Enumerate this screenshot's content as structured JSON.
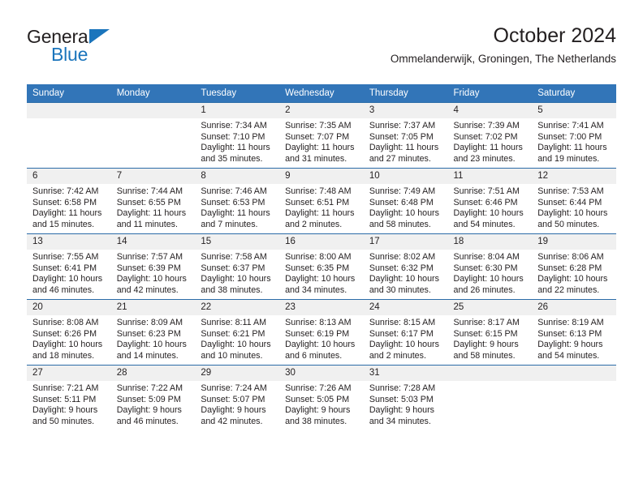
{
  "brand": {
    "name_top": "General",
    "name_bottom": "Blue",
    "triangle_color": "#1b75bc"
  },
  "header": {
    "title": "October 2024",
    "subtitle": "Ommelanderwijk, Groningen, The Netherlands"
  },
  "colors": {
    "header_blue": "#3275b8",
    "daynum_band": "#f0f0f0",
    "text": "#231f20"
  },
  "weekday_headers": [
    "Sunday",
    "Monday",
    "Tuesday",
    "Wednesday",
    "Thursday",
    "Friday",
    "Saturday"
  ],
  "labels": {
    "sunrise_prefix": "Sunrise:",
    "sunset_prefix": "Sunset:",
    "daylight_prefix": "Daylight:"
  },
  "weeks": [
    [
      {
        "day": "",
        "empty": true
      },
      {
        "day": "",
        "empty": true
      },
      {
        "day": "1",
        "sunrise": "Sunrise: 7:34 AM",
        "sunset": "Sunset: 7:10 PM",
        "daylight1": "Daylight: 11 hours",
        "daylight2": "and 35 minutes."
      },
      {
        "day": "2",
        "sunrise": "Sunrise: 7:35 AM",
        "sunset": "Sunset: 7:07 PM",
        "daylight1": "Daylight: 11 hours",
        "daylight2": "and 31 minutes."
      },
      {
        "day": "3",
        "sunrise": "Sunrise: 7:37 AM",
        "sunset": "Sunset: 7:05 PM",
        "daylight1": "Daylight: 11 hours",
        "daylight2": "and 27 minutes."
      },
      {
        "day": "4",
        "sunrise": "Sunrise: 7:39 AM",
        "sunset": "Sunset: 7:02 PM",
        "daylight1": "Daylight: 11 hours",
        "daylight2": "and 23 minutes."
      },
      {
        "day": "5",
        "sunrise": "Sunrise: 7:41 AM",
        "sunset": "Sunset: 7:00 PM",
        "daylight1": "Daylight: 11 hours",
        "daylight2": "and 19 minutes."
      }
    ],
    [
      {
        "day": "6",
        "sunrise": "Sunrise: 7:42 AM",
        "sunset": "Sunset: 6:58 PM",
        "daylight1": "Daylight: 11 hours",
        "daylight2": "and 15 minutes."
      },
      {
        "day": "7",
        "sunrise": "Sunrise: 7:44 AM",
        "sunset": "Sunset: 6:55 PM",
        "daylight1": "Daylight: 11 hours",
        "daylight2": "and 11 minutes."
      },
      {
        "day": "8",
        "sunrise": "Sunrise: 7:46 AM",
        "sunset": "Sunset: 6:53 PM",
        "daylight1": "Daylight: 11 hours",
        "daylight2": "and 7 minutes."
      },
      {
        "day": "9",
        "sunrise": "Sunrise: 7:48 AM",
        "sunset": "Sunset: 6:51 PM",
        "daylight1": "Daylight: 11 hours",
        "daylight2": "and 2 minutes."
      },
      {
        "day": "10",
        "sunrise": "Sunrise: 7:49 AM",
        "sunset": "Sunset: 6:48 PM",
        "daylight1": "Daylight: 10 hours",
        "daylight2": "and 58 minutes."
      },
      {
        "day": "11",
        "sunrise": "Sunrise: 7:51 AM",
        "sunset": "Sunset: 6:46 PM",
        "daylight1": "Daylight: 10 hours",
        "daylight2": "and 54 minutes."
      },
      {
        "day": "12",
        "sunrise": "Sunrise: 7:53 AM",
        "sunset": "Sunset: 6:44 PM",
        "daylight1": "Daylight: 10 hours",
        "daylight2": "and 50 minutes."
      }
    ],
    [
      {
        "day": "13",
        "sunrise": "Sunrise: 7:55 AM",
        "sunset": "Sunset: 6:41 PM",
        "daylight1": "Daylight: 10 hours",
        "daylight2": "and 46 minutes."
      },
      {
        "day": "14",
        "sunrise": "Sunrise: 7:57 AM",
        "sunset": "Sunset: 6:39 PM",
        "daylight1": "Daylight: 10 hours",
        "daylight2": "and 42 minutes."
      },
      {
        "day": "15",
        "sunrise": "Sunrise: 7:58 AM",
        "sunset": "Sunset: 6:37 PM",
        "daylight1": "Daylight: 10 hours",
        "daylight2": "and 38 minutes."
      },
      {
        "day": "16",
        "sunrise": "Sunrise: 8:00 AM",
        "sunset": "Sunset: 6:35 PM",
        "daylight1": "Daylight: 10 hours",
        "daylight2": "and 34 minutes."
      },
      {
        "day": "17",
        "sunrise": "Sunrise: 8:02 AM",
        "sunset": "Sunset: 6:32 PM",
        "daylight1": "Daylight: 10 hours",
        "daylight2": "and 30 minutes."
      },
      {
        "day": "18",
        "sunrise": "Sunrise: 8:04 AM",
        "sunset": "Sunset: 6:30 PM",
        "daylight1": "Daylight: 10 hours",
        "daylight2": "and 26 minutes."
      },
      {
        "day": "19",
        "sunrise": "Sunrise: 8:06 AM",
        "sunset": "Sunset: 6:28 PM",
        "daylight1": "Daylight: 10 hours",
        "daylight2": "and 22 minutes."
      }
    ],
    [
      {
        "day": "20",
        "sunrise": "Sunrise: 8:08 AM",
        "sunset": "Sunset: 6:26 PM",
        "daylight1": "Daylight: 10 hours",
        "daylight2": "and 18 minutes."
      },
      {
        "day": "21",
        "sunrise": "Sunrise: 8:09 AM",
        "sunset": "Sunset: 6:23 PM",
        "daylight1": "Daylight: 10 hours",
        "daylight2": "and 14 minutes."
      },
      {
        "day": "22",
        "sunrise": "Sunrise: 8:11 AM",
        "sunset": "Sunset: 6:21 PM",
        "daylight1": "Daylight: 10 hours",
        "daylight2": "and 10 minutes."
      },
      {
        "day": "23",
        "sunrise": "Sunrise: 8:13 AM",
        "sunset": "Sunset: 6:19 PM",
        "daylight1": "Daylight: 10 hours",
        "daylight2": "and 6 minutes."
      },
      {
        "day": "24",
        "sunrise": "Sunrise: 8:15 AM",
        "sunset": "Sunset: 6:17 PM",
        "daylight1": "Daylight: 10 hours",
        "daylight2": "and 2 minutes."
      },
      {
        "day": "25",
        "sunrise": "Sunrise: 8:17 AM",
        "sunset": "Sunset: 6:15 PM",
        "daylight1": "Daylight: 9 hours",
        "daylight2": "and 58 minutes."
      },
      {
        "day": "26",
        "sunrise": "Sunrise: 8:19 AM",
        "sunset": "Sunset: 6:13 PM",
        "daylight1": "Daylight: 9 hours",
        "daylight2": "and 54 minutes."
      }
    ],
    [
      {
        "day": "27",
        "sunrise": "Sunrise: 7:21 AM",
        "sunset": "Sunset: 5:11 PM",
        "daylight1": "Daylight: 9 hours",
        "daylight2": "and 50 minutes."
      },
      {
        "day": "28",
        "sunrise": "Sunrise: 7:22 AM",
        "sunset": "Sunset: 5:09 PM",
        "daylight1": "Daylight: 9 hours",
        "daylight2": "and 46 minutes."
      },
      {
        "day": "29",
        "sunrise": "Sunrise: 7:24 AM",
        "sunset": "Sunset: 5:07 PM",
        "daylight1": "Daylight: 9 hours",
        "daylight2": "and 42 minutes."
      },
      {
        "day": "30",
        "sunrise": "Sunrise: 7:26 AM",
        "sunset": "Sunset: 5:05 PM",
        "daylight1": "Daylight: 9 hours",
        "daylight2": "and 38 minutes."
      },
      {
        "day": "31",
        "sunrise": "Sunrise: 7:28 AM",
        "sunset": "Sunset: 5:03 PM",
        "daylight1": "Daylight: 9 hours",
        "daylight2": "and 34 minutes."
      },
      {
        "day": "",
        "empty": true
      },
      {
        "day": "",
        "empty": true
      }
    ]
  ]
}
